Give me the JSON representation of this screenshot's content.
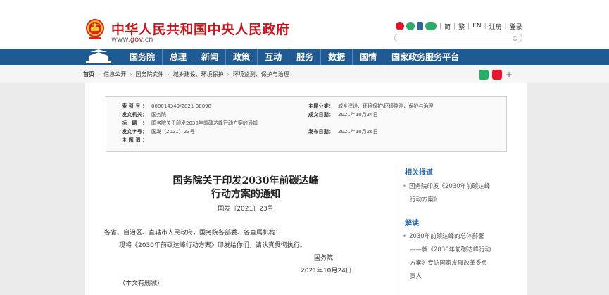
{
  "header": {
    "site_title": "中华人民共和国中央人民政府",
    "site_url_pre": "www.",
    "site_url_gov": "gov",
    "site_url_post": ".cn",
    "lang_simplified": "简",
    "lang_traditional": "繁",
    "lang_en": "EN",
    "register": "注册",
    "login": "登录",
    "divider": "|"
  },
  "nav": {
    "items": [
      "国务院",
      "总理",
      "新闻",
      "政策",
      "互动",
      "服务",
      "数据",
      "国情",
      "国家政务服务平台"
    ]
  },
  "breadcrumb": {
    "items": [
      "首页",
      "信息公开",
      "国务院文件",
      "城乡建设、环境保护",
      "环境监测、保护与治理"
    ],
    "sep": "›"
  },
  "info": {
    "index_label": "索引号：",
    "index_value": "000014349/2021-00098",
    "topic_label": "主题分类：",
    "topic_value": "城乡建设、环境保护\\环境监测、保护与治理",
    "issuer_label": "发文机关：",
    "issuer_value": "国务院",
    "written_label": "成文日期：",
    "written_value": "2021年10月24日",
    "title_label": "标题：",
    "title_value": "国务院关于印发2030年前碳达峰行动方案的通知",
    "docno_label": "发文字号：",
    "docno_value": "国发〔2021〕23号",
    "published_label": "发布日期：",
    "published_value": "2021年10月26日",
    "subject_label": "主题词："
  },
  "doc": {
    "title_line1": "国务院关于印发2030年前碳达峰",
    "title_line2": "行动方案的通知",
    "number": "国发〔2021〕23号",
    "salutation": "各省、自治区、直辖市人民政府，国务院各部委、各直属机构：",
    "body": "现将《2030年前碳达峰行动方案》印发给你们，请认真贯彻执行。",
    "signer": "国务院",
    "date": "2021年10月24日",
    "note": "（本文有删减）"
  },
  "side": {
    "related_title": "相关报道",
    "related_line1": "国务院印发《2030年前碳达峰",
    "related_line2": "行动方案》",
    "interp_title": "解读",
    "interp_line1": "2030年前碳达峰的总体部署",
    "interp_line2": "——就《2030年前碳达峰行动",
    "interp_line3": "方案》专访国家发展改革委负",
    "interp_line4": "责人"
  },
  "colors": {
    "brand_red": "#c8161d",
    "nav_blue": "#1f5a93",
    "link_blue": "#2c67a3"
  },
  "icons": [
    "national-emblem-icon",
    "weibo-icon",
    "wechat-icon",
    "mobile-icon",
    "search-icon",
    "tiananmen-logo-icon",
    "plus-icon"
  ]
}
